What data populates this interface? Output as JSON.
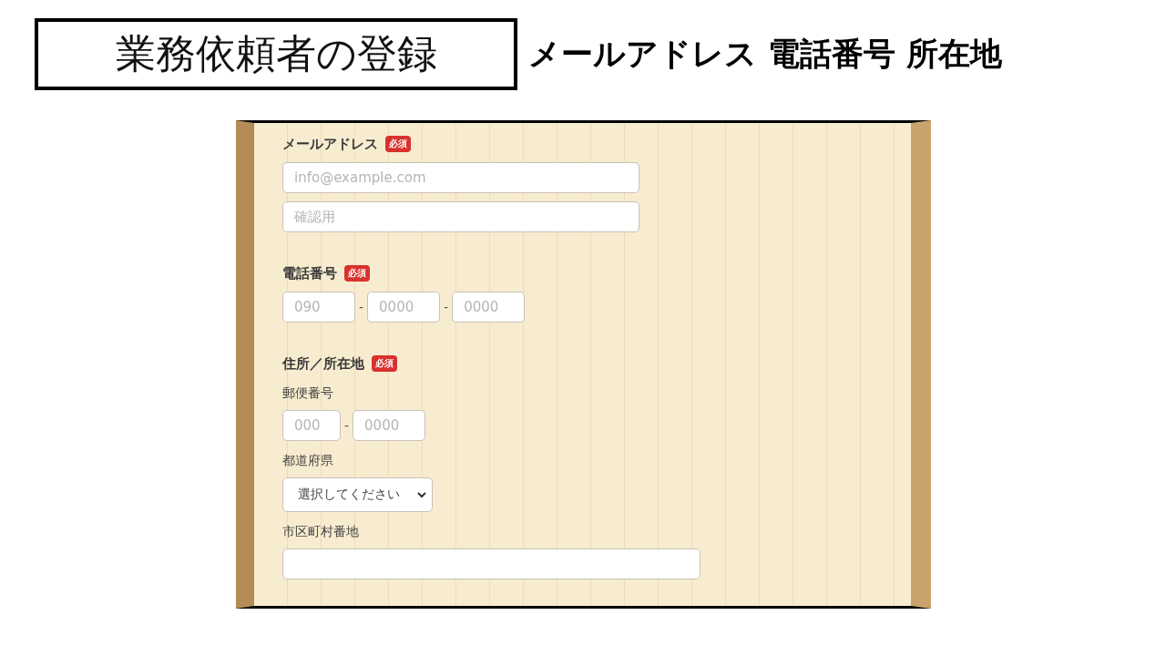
{
  "slide": {
    "title": "業務依頼者の登録",
    "heading": "メールアドレス 電話番号 所在地"
  },
  "form": {
    "sections": [
      {
        "label": "メールアドレス",
        "badge": "必須",
        "items": [
          {
            "kind": "input",
            "placeholder": "info@example.com"
          },
          {
            "kind": "input",
            "placeholder": "確認用"
          }
        ]
      },
      {
        "label": "電話番号",
        "badge": "必須",
        "items": [
          {
            "kind": "split",
            "parts": [
              {
                "kind": "field",
                "placeholder": "090"
              },
              {
                "kind": "dash",
                "text": "-"
              },
              {
                "kind": "field",
                "placeholder": "0000"
              },
              {
                "kind": "dash",
                "text": "-"
              },
              {
                "kind": "field",
                "placeholder": "0000"
              }
            ]
          }
        ]
      },
      {
        "label": "住所／所在地",
        "badge": "必須",
        "items": [
          {
            "kind": "sublabel",
            "text": "郵便番号"
          },
          {
            "kind": "split",
            "parts": [
              {
                "kind": "short-field",
                "placeholder": "000"
              },
              {
                "kind": "dash",
                "text": "-"
              },
              {
                "kind": "field",
                "placeholder": "0000"
              }
            ]
          },
          {
            "kind": "sublabel",
            "text": "都道府県"
          },
          {
            "kind": "select",
            "value": "選択してください"
          },
          {
            "kind": "sublabel",
            "text": "市区町村番地"
          },
          {
            "kind": "wide-input"
          }
        ]
      }
    ]
  }
}
